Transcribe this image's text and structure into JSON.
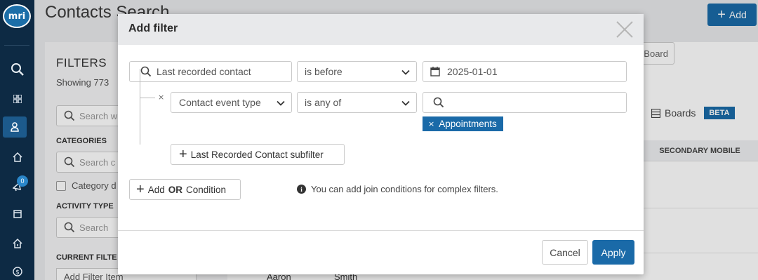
{
  "app": {
    "logo_text": "mri",
    "page_title": "Contacts Search",
    "add_label": "Add",
    "nav_badge": "0",
    "accent_color": "#1a6aa8",
    "nav_icons": [
      "search-icon",
      "grid-icon",
      "person-icon",
      "home-icon",
      "megaphone-icon",
      "calendar-icon",
      "house-key-icon",
      "dollar-icon"
    ]
  },
  "filters_panel": {
    "title": "FILTERS",
    "showing": "Showing 773",
    "search_placeholder": "Search w",
    "categories_label": "CATEGORIES",
    "categories_search": "Search c",
    "category_check_label": "Category d",
    "activity_type_label": "ACTIVITY TYPE",
    "activity_search": "Search",
    "current_filters_label": "CURRENT FILTE",
    "add_filter_item": "Add Filter Item"
  },
  "main": {
    "board_btn": "Board",
    "boards_label": "Boards",
    "beta_badge": "BETA",
    "column_header": "SECONDARY MOBILE",
    "first_name": "Aaron",
    "last_name": "Smith"
  },
  "modal": {
    "title": "Add filter",
    "row1": {
      "field": "Last recorded contact",
      "operator": "is before",
      "value": "2025-01-01"
    },
    "row2": {
      "remove": "×",
      "field": "Contact event type",
      "operator": "is any of",
      "search_value": "",
      "chips": [
        {
          "label": "Appointments",
          "remove": "×"
        }
      ]
    },
    "subfilter_button": "Last Recorded Contact subfilter",
    "add_condition": {
      "prefix": "Add",
      "bold": "OR",
      "suffix": "Condition"
    },
    "info_text": "You can add join conditions for complex filters.",
    "cancel_label": "Cancel",
    "apply_label": "Apply"
  }
}
